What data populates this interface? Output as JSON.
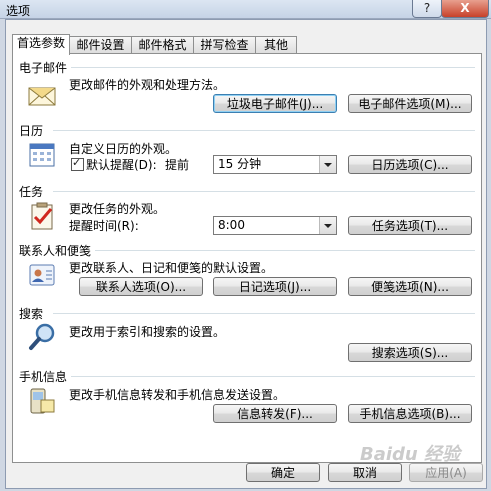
{
  "window": {
    "title": "选项",
    "help": "?",
    "close": "X"
  },
  "tabs": [
    "首选参数",
    "邮件设置",
    "邮件格式",
    "拼写检查",
    "其他"
  ],
  "email": {
    "title": "电子邮件",
    "desc": "更改邮件的外观和处理方法。",
    "junk_btn": "垃圾电子邮件(J)...",
    "options_btn": "电子邮件选项(M)..."
  },
  "calendar": {
    "title": "日历",
    "desc": "自定义日历的外观。",
    "reminder_label": "默认提醒(D):",
    "advance_label": "提前",
    "reminder_value": "15 分钟",
    "options_btn": "日历选项(C)..."
  },
  "tasks": {
    "title": "任务",
    "desc": "更改任务的外观。",
    "time_label": "提醒时间(R):",
    "time_value": "8:00",
    "options_btn": "任务选项(T)..."
  },
  "contacts": {
    "title": "联系人和便笺",
    "desc": "更改联系人、日记和便笺的默认设置。",
    "contact_btn": "联系人选项(O)...",
    "journal_btn": "日记选项(J)...",
    "notes_btn": "便笺选项(N)..."
  },
  "search": {
    "title": "搜索",
    "desc": "更改用于索引和搜索的设置。",
    "options_btn": "搜索选项(S)..."
  },
  "mobile": {
    "title": "手机信息",
    "desc": "更改手机信息转发和手机信息发送设置。",
    "forward_btn": "信息转发(F)...",
    "options_btn": "手机信息选项(B)..."
  },
  "footer": {
    "ok": "确定",
    "cancel": "取消",
    "apply": "应用(A)"
  },
  "watermark": "Baidu 经验"
}
